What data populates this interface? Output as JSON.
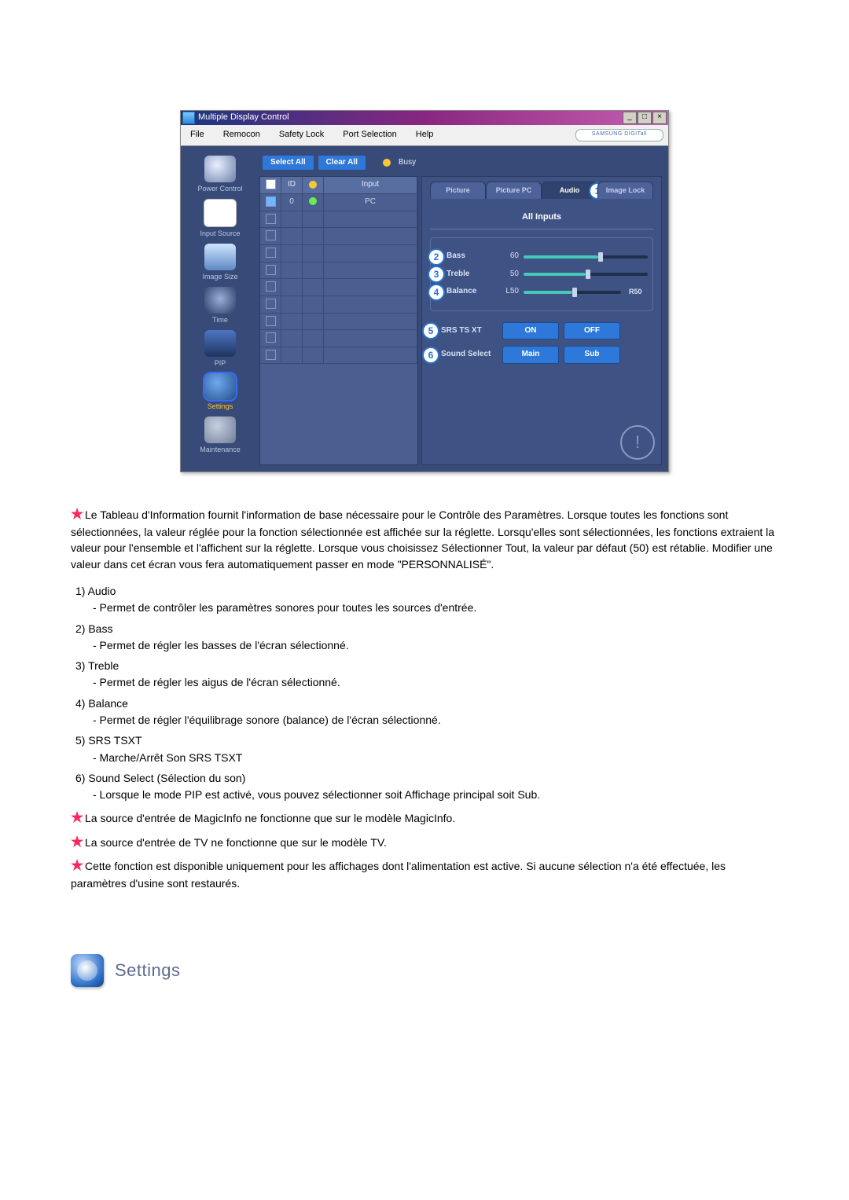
{
  "window": {
    "title": "Multiple Display Control",
    "menu": [
      "File",
      "Remocon",
      "Safety Lock",
      "Port Selection",
      "Help"
    ],
    "brand": "SAMSUNG DIGITall"
  },
  "sidebar": {
    "items": [
      {
        "label": "Power Control",
        "icon": "power"
      },
      {
        "label": "Input Source",
        "icon": "input"
      },
      {
        "label": "Image Size",
        "icon": "image"
      },
      {
        "label": "Time",
        "icon": "time"
      },
      {
        "label": "PIP",
        "icon": "pip"
      },
      {
        "label": "Settings",
        "icon": "settings",
        "selected": true
      },
      {
        "label": "Maintenance",
        "icon": "maint"
      }
    ]
  },
  "toolbar": {
    "select_all": "Select All",
    "clear_all": "Clear All",
    "busy": "Busy"
  },
  "table": {
    "headers": {
      "check": "✓",
      "id": "ID",
      "status": "",
      "input": "Input"
    },
    "rows": [
      {
        "checked": true,
        "id": "0",
        "status": "green",
        "input": "PC"
      }
    ],
    "blank_rows": 9
  },
  "panel": {
    "tabs": [
      {
        "label": "Picture"
      },
      {
        "label": "Picture PC"
      },
      {
        "label": "Audio",
        "marker": "1",
        "active": true
      },
      {
        "label": "Image Lock"
      }
    ],
    "heading": "All Inputs",
    "sliders": [
      {
        "label": "Bass",
        "value": "60",
        "fill": 60,
        "marker": "2"
      },
      {
        "label": "Treble",
        "value": "50",
        "fill": 50,
        "marker": "3"
      },
      {
        "label": "Balance",
        "left": "L50",
        "right": "R50",
        "fill": 50,
        "marker": "4"
      }
    ],
    "button_rows": [
      {
        "label": "SRS TS XT",
        "a": "ON",
        "b": "OFF",
        "marker": "5"
      },
      {
        "label": "Sound Select",
        "a": "Main",
        "b": "Sub",
        "marker": "6"
      }
    ]
  },
  "notes": {
    "intro": "Le Tableau d'Information fournit l'information de base nécessaire pour le Contrôle des Paramètres. Lorsque toutes les fonctions sont sélectionnées, la valeur réglée pour la fonction sélectionnée est affichée sur la réglette. Lorsqu'elles sont sélectionnées, les fonctions extraient la valeur pour l'ensemble et l'affichent sur la réglette. Lorsque vous choisissez Sélectionner Tout, la valeur par défaut (50) est rétablie. Modifier une valeur dans cet écran vous fera automatiquement passer en mode \"PERSONNALISÉ\".",
    "list": [
      {
        "n": "1)",
        "t": "Audio",
        "d": "- Permet de contrôler les paramètres sonores pour toutes les sources d'entrée."
      },
      {
        "n": "2)",
        "t": "Bass",
        "d": "- Permet de régler les basses de l'écran sélectionné."
      },
      {
        "n": "3)",
        "t": "Treble",
        "d": "- Permet de régler les aigus de l'écran sélectionné."
      },
      {
        "n": "4)",
        "t": "Balance",
        "d": "- Permet de régler l'équilibrage sonore (balance) de l'écran sélectionné."
      },
      {
        "n": "5)",
        "t": "SRS TSXT",
        "d": "- Marche/Arrêt Son SRS TSXT"
      },
      {
        "n": "6)",
        "t": "Sound Select (Sélection du son)",
        "d": "- Lorsque le mode PIP est activé, vous pouvez sélectionner soit Affichage principal soit Sub."
      }
    ],
    "foot": [
      "La source d'entrée de MagicInfo ne fonctionne que sur le modèle MagicInfo.",
      "La source d'entrée de TV ne fonctionne que sur le modèle TV.",
      "Cette fonction est disponible uniquement pour les affichages dont l'alimentation est active. Si aucune sélection n'a été effectuée, les paramètres d'usine sont restaurés."
    ]
  },
  "section": {
    "title": "Settings"
  }
}
